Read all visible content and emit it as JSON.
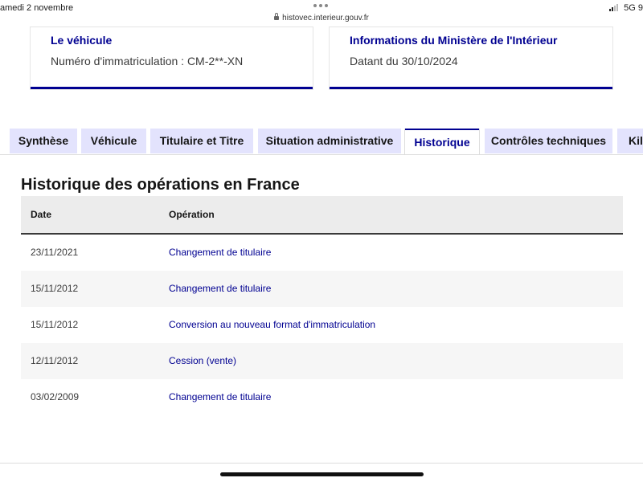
{
  "status_bar": {
    "date": "amedi 2 novembre",
    "url": "histovec.interieur.gouv.fr",
    "network": "5G",
    "battery": "9"
  },
  "cards": {
    "vehicle": {
      "title": "Le véhicule",
      "text": "Numéro d'immatriculation : CM-2**-XN"
    },
    "ministere": {
      "title": "Informations du Ministère de l'Intérieur",
      "text": "Datant du 30/10/2024"
    }
  },
  "tabs": [
    {
      "label": "Synthèse"
    },
    {
      "label": "Véhicule"
    },
    {
      "label": "Titulaire et Titre"
    },
    {
      "label": "Situation administrative"
    },
    {
      "label": "Historique",
      "active": true
    },
    {
      "label": "Contrôles techniques"
    },
    {
      "label": "Kilo"
    }
  ],
  "section": {
    "title": "Historique des opérations en France"
  },
  "table": {
    "columns": [
      "Date",
      "Opération"
    ],
    "rows": [
      {
        "date": "23/11/2021",
        "operation": "Changement de titulaire"
      },
      {
        "date": "15/11/2012",
        "operation": "Changement de titulaire"
      },
      {
        "date": "15/11/2012",
        "operation": "Conversion au nouveau format d'immatriculation"
      },
      {
        "date": "12/11/2012",
        "operation": "Cession (vente)"
      },
      {
        "date": "03/02/2009",
        "operation": "Changement de titulaire"
      }
    ]
  },
  "colors": {
    "accent": "#000091",
    "tab_bg": "#e3e3fd",
    "row_alt": "#f6f6f6",
    "header_bg": "#ececec"
  }
}
